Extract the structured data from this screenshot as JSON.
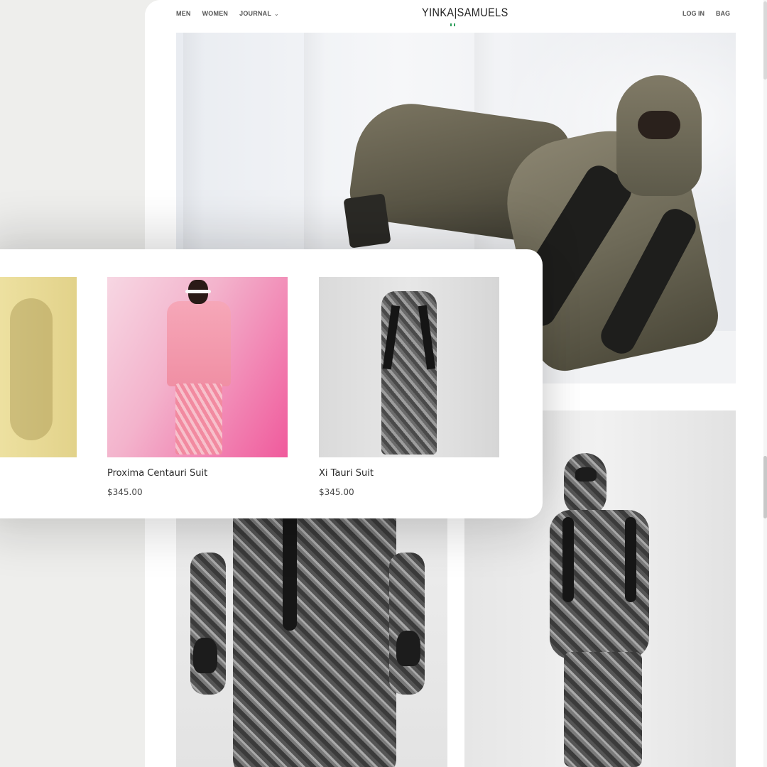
{
  "site": {
    "nav_left": [
      {
        "label": "MEN"
      },
      {
        "label": "WOMEN"
      },
      {
        "label": "JOURNAL"
      }
    ],
    "brand": "YINKA|SAMUELS",
    "nav_right": [
      {
        "label": "LOG IN"
      },
      {
        "label": "BAG"
      }
    ],
    "accent_color": "#2e9e5b"
  },
  "product_card": {
    "products": [
      {
        "name": "",
        "price": ""
      },
      {
        "name": "Proxima Centauri Suit",
        "price": "$345.00"
      },
      {
        "name": "Xi Tauri Suit",
        "price": "$345.00"
      }
    ]
  }
}
